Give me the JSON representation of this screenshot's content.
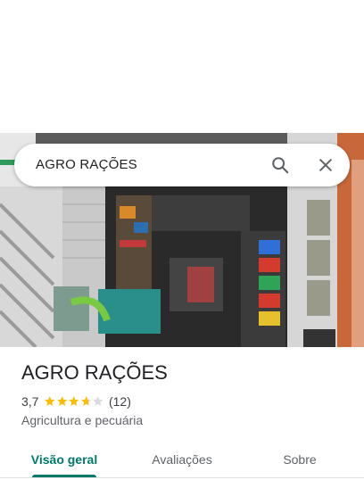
{
  "search": {
    "query": "AGRO RAÇÕES",
    "search_icon": "search-icon",
    "close_icon": "close-icon"
  },
  "place": {
    "name": "AGRO RAÇÕES",
    "rating": "3,7",
    "rating_value": 3.7,
    "max_stars": 5,
    "reviews_count": "(12)",
    "category": "Agricultura e pecuária"
  },
  "tabs": [
    {
      "label": "Visão geral",
      "active": true
    },
    {
      "label": "Avaliações",
      "active": false
    },
    {
      "label": "Sobre",
      "active": false
    }
  ],
  "colors": {
    "accent": "#00796b",
    "star": "#fbbc04",
    "star_empty": "#dadce0"
  }
}
